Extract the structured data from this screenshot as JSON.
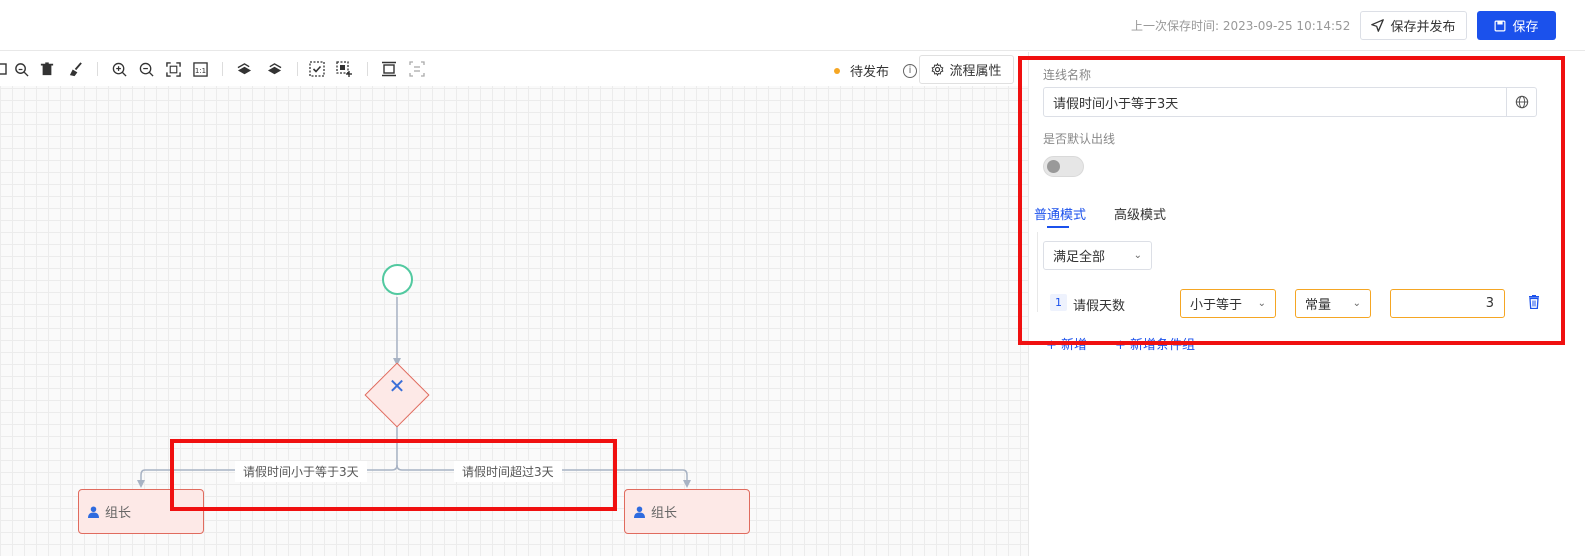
{
  "header": {
    "last_save_label": "上一次保存时间:",
    "last_save_time": "2023-09-25 10:14:52",
    "publish_label": "保存并发布",
    "save_label": "保存"
  },
  "toolbar": {
    "status": "待发布",
    "process_props": "流程属性"
  },
  "flow": {
    "edge_left_label": "请假时间小于等于3天",
    "edge_right_label": "请假时间超过3天",
    "task_left": "组长",
    "task_right": "组长"
  },
  "panel": {
    "line_name_label": "连线名称",
    "line_name_value": "请假时间小于等于3天",
    "default_line_label": "是否默认出线",
    "default_line_on": false,
    "tabs": [
      "普通模式",
      "高级模式"
    ],
    "active_tab": "普通模式",
    "match_mode": "满足全部",
    "condition": {
      "index": "1",
      "field": "请假天数",
      "operator": "小于等于",
      "value_type": "常量",
      "value": "3"
    },
    "add_label": "新增",
    "add_group_label": "新增条件组"
  },
  "colors": {
    "primary": "#1b51ec",
    "warning": "#f5a623",
    "node_border": "#e06b5e",
    "node_fill": "#fde9e7",
    "start_border": "#52c9a0",
    "highlight": "#f01010"
  }
}
